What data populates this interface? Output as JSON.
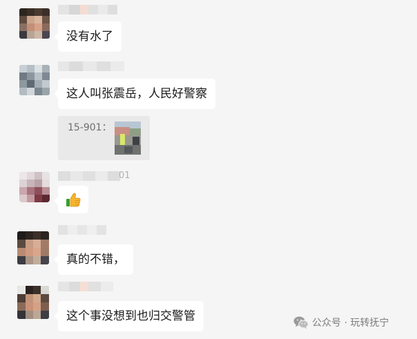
{
  "messages": [
    {
      "text": "没有水了"
    },
    {
      "text": "这人叫张震岳，人民好警察"
    },
    {
      "quote": {
        "text": "15-901："
      }
    },
    {
      "name_suffix": "01",
      "emoji": "thumbs-up-icon"
    },
    {
      "text": "真的不错，"
    },
    {
      "text": "这个事没想到也归交警管"
    }
  ],
  "watermark": {
    "label": "公众号 · 玩转抚宁",
    "icon": "wechat-icon"
  },
  "colors": {
    "background": "#f5f5f5",
    "bubble": "#ffffff",
    "quote_card": "#e9e9e9"
  }
}
